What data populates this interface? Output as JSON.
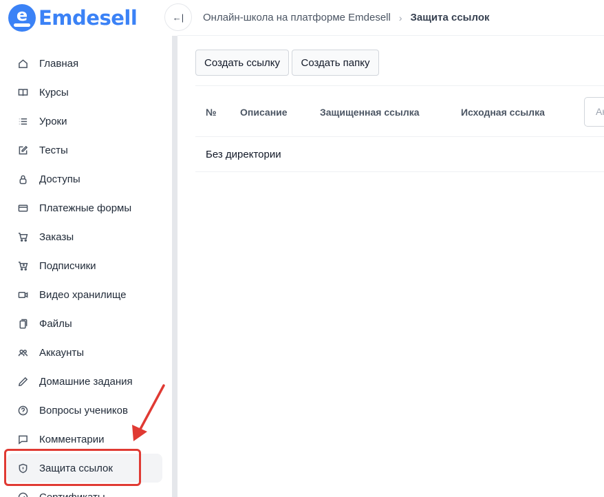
{
  "app": {
    "logo_letter": "e",
    "logo_text": "Emdesell",
    "brand_color": "#3b82f6"
  },
  "sidebar": {
    "items": [
      {
        "label": "Главная",
        "icon": "home-icon"
      },
      {
        "label": "Курсы",
        "icon": "book-icon"
      },
      {
        "label": "Уроки",
        "icon": "list-icon"
      },
      {
        "label": "Тесты",
        "icon": "edit-icon"
      },
      {
        "label": "Доступы",
        "icon": "lock-icon"
      },
      {
        "label": "Платежные формы",
        "icon": "credit-card-icon"
      },
      {
        "label": "Заказы",
        "icon": "cart-icon"
      },
      {
        "label": "Подписчики",
        "icon": "cart-plus-icon"
      },
      {
        "label": "Видео хранилище",
        "icon": "video-icon"
      },
      {
        "label": "Файлы",
        "icon": "files-icon"
      },
      {
        "label": "Аккаунты",
        "icon": "users-icon"
      },
      {
        "label": "Домашние задания",
        "icon": "pencil-icon"
      },
      {
        "label": "Вопросы учеников",
        "icon": "question-icon"
      },
      {
        "label": "Комментарии",
        "icon": "comment-icon"
      },
      {
        "label": "Защита ссылок",
        "icon": "shield-icon",
        "active": true
      },
      {
        "label": "Сертификаты",
        "icon": "certificate-icon"
      }
    ]
  },
  "topbar": {
    "collapse_glyph": "←|",
    "breadcrumb_parent": "Онлайн-школа на платформе Emdesell",
    "breadcrumb_separator": "›",
    "breadcrumb_current": "Защита ссылок"
  },
  "toolbar": {
    "create_link_label": "Создать ссылку",
    "create_folder_label": "Создать папку"
  },
  "table": {
    "columns": [
      "№",
      "Описание",
      "Защищенная ссылка",
      "Исходная ссылка"
    ],
    "search_placeholder": "Ан",
    "rows": [
      {
        "label": "Без директории"
      }
    ]
  },
  "annotation": {
    "color": "#e03a33"
  }
}
